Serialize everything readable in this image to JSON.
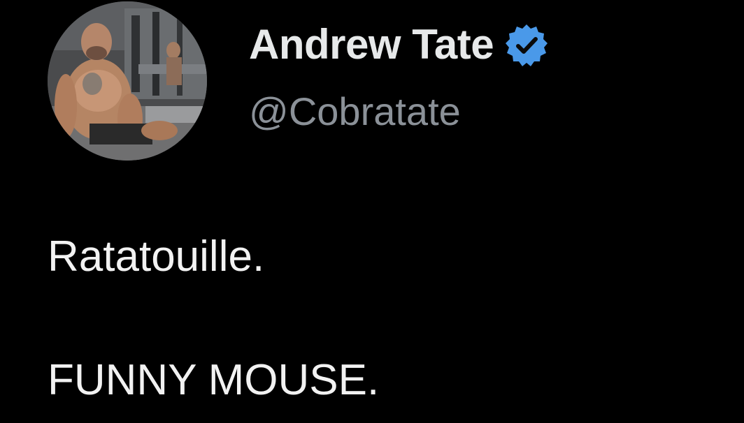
{
  "author": {
    "display_name": "Andrew Tate",
    "handle": "@Cobratate",
    "verified": true,
    "verified_badge_color": "#4a99e9"
  },
  "tweet": {
    "lines": [
      "Ratatouille.",
      "FUNNY MOUSE."
    ]
  },
  "colors": {
    "background": "#000000",
    "name_text": "#e7e9ea",
    "handle_text": "#8b9198",
    "body_text": "#f2f2f2"
  },
  "icons": {
    "verified": "verified-badge-icon",
    "avatar": "profile-photo"
  }
}
